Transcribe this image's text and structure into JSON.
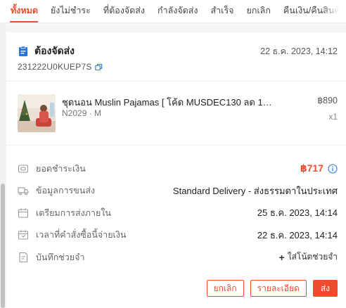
{
  "tabs": [
    {
      "label": "ทั้งหมด",
      "active": true
    },
    {
      "label": "ยังไม่ชำระ"
    },
    {
      "label": "ที่ต้องจัดส่ง"
    },
    {
      "label": "กำลังจัดส่ง"
    },
    {
      "label": "สำเร็จ"
    },
    {
      "label": "ยกเลิก"
    },
    {
      "label": "คืนเงิน/คืนสินค้า"
    }
  ],
  "order": {
    "status": "ต้องจัดส่ง",
    "time": "22 ธ.ค. 2023, 14:12",
    "id": "231222U0KUEP7S"
  },
  "product": {
    "title": "ชุดนอน Muslin Pajamas [ โค้ด MUSDEC130 ลด 130 B...",
    "variant": "N2029 · M",
    "price": "฿890",
    "qty": "x1"
  },
  "info": {
    "payment_label": "ยอดชำระเงิน",
    "payment_value": "฿717",
    "shipping_label": "ข้อมูลการขนส่ง",
    "shipping_value": "Standard Delivery - ส่งธรรมดาในประเทศ",
    "ship_by_label": "เตรียมการส่งภายใน",
    "ship_by_value": "25 ธ.ค. 2023, 14:14",
    "paid_label": "เวลาที่คำสั่งซื้อนี้จ่ายเงิน",
    "paid_value": "22 ธ.ค. 2023, 14:14",
    "note_label": "บันทึกช่วยจำ",
    "note_action": "ใส่โน้ตช่วยจำ"
  },
  "actions": {
    "cancel": "ยกเลิก",
    "details": "รายละเอียด",
    "ship": "ส่ง"
  },
  "colors": {
    "accent": "#ee4d2d",
    "status_icon": "#2673dd"
  }
}
